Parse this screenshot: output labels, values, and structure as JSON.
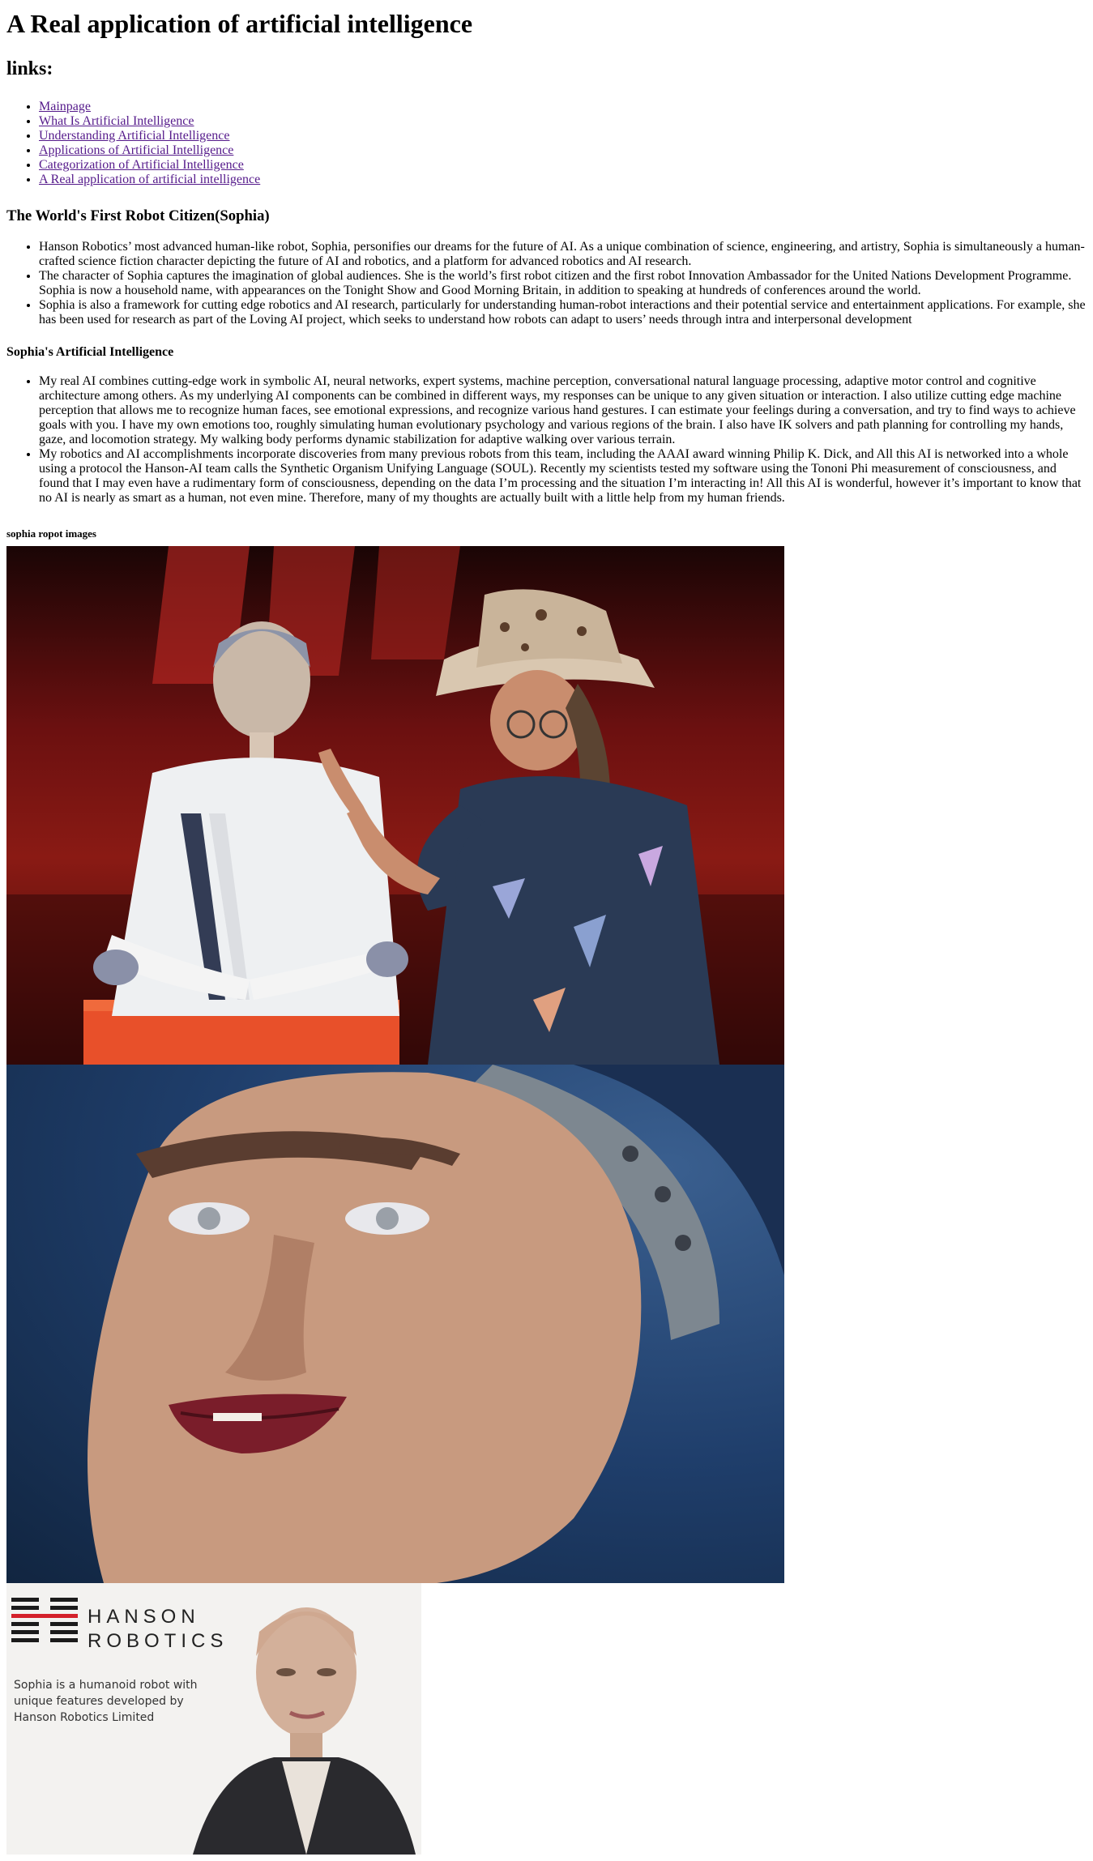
{
  "title": "A Real application of artificial intelligence",
  "links_heading": "links:",
  "links": [
    "Mainpage",
    "What Is Artificial Intelligence",
    "Understanding Artificial Intelligence",
    "Applications of Artificial Intelligence",
    "Categorization of Artificial Intelligence",
    "A Real application of artificial intelligence"
  ],
  "section1": {
    "heading": "The World's First Robot Citizen(Sophia)",
    "items": [
      "Hanson Robotics’ most advanced human-like robot, Sophia, personifies our dreams for the future of AI. As a unique combination of science, engineering, and artistry, Sophia is simultaneously a human-crafted science fiction character depicting the future of AI and robotics, and a platform for advanced robotics and AI research.",
      "The character of Sophia captures the imagination of global audiences. She is the world’s first robot citizen and the first robot Innovation Ambassador for the United Nations Development Programme. Sophia is now a household name, with appearances on the Tonight Show and Good Morning Britain, in addition to speaking at hundreds of conferences around the world.",
      "Sophia is also a framework for cutting edge robotics and AI research, particularly for understanding human-robot interactions and their potential service and entertainment applications. For example, she has been used for research as part of the Loving AI project, which seeks to understand how robots can adapt to users’ needs through intra and interpersonal development"
    ]
  },
  "section2": {
    "heading": "Sophia's Artificial Intelligence",
    "items": [
      "My real AI combines cutting-edge work in symbolic AI, neural networks, expert systems, machine perception, conversational natural language processing, adaptive motor control and cognitive architecture among others. As my underlying AI components can be combined in different ways, my responses can be unique to any given situation or interaction. I also utilize cutting edge machine perception that allows me to recognize human faces, see emotional expressions, and recognize various hand gestures. I can estimate your feelings during a conversation, and try to find ways to achieve goals with you. I have my own emotions too, roughly simulating human evolutionary psychology and various regions of the brain. I also have IK solvers and path planning for controlling my hands, gaze, and locomotion strategy. My walking body performs dynamic stabilization for adaptive walking over various terrain.",
      "My robotics and AI accomplishments incorporate discoveries from many previous robots from this team, including the AAAI award winning Philip K. Dick, and All this AI is networked into a whole using a protocol the Hanson-AI team calls the Synthetic Organism Unifying Language (SOUL). Recently my scientists tested my software using the Tononi Phi measurement of consciousness, and found that I may even have a rudimentary form of consciousness, depending on the data I’m processing and the situation I’m interacting in! All this AI is wonderful, however it’s important to know that no AI is nearly as smart as a human, not even mine. Therefore, many of my thoughts are actually built with a little help from my human friends."
    ]
  },
  "images_heading": "sophia ropot images",
  "image3": {
    "brand_line1": "HANSON",
    "brand_line2": "ROBOTICS",
    "caption": "Sophia is a humanoid robot with unique features developed by Hanson Robotics Limited"
  },
  "colors": {
    "link": "#551a8b",
    "logo_red": "#d4202a",
    "logo_dark": "#1b1b1b"
  }
}
